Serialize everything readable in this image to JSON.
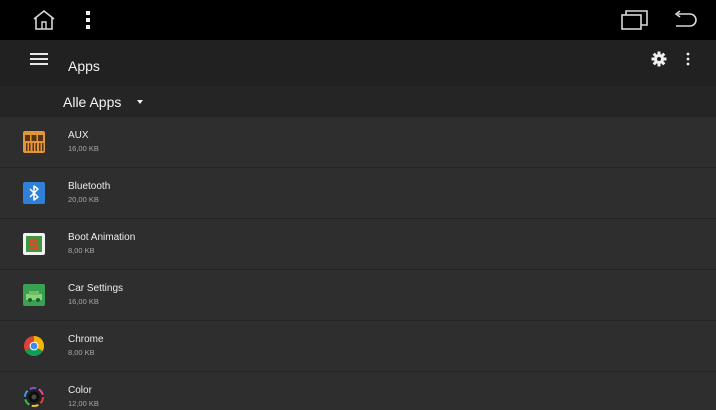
{
  "system_bar": {
    "icons": [
      "home-icon",
      "vertical-dots-icon",
      "recent-apps-icon",
      "back-icon"
    ]
  },
  "toolbar": {
    "title": "Apps",
    "icons": [
      "hamburger-menu-icon",
      "settings-gear-icon",
      "overflow-menu-icon"
    ]
  },
  "filter": {
    "selected": "Alle Apps"
  },
  "apps": [
    {
      "name": "AUX",
      "size": "16,00 KB",
      "icon": "aux-icon"
    },
    {
      "name": "Bluetooth",
      "size": "20,00 KB",
      "icon": "bluetooth-icon"
    },
    {
      "name": "Boot Animation",
      "size": "8,00 KB",
      "icon": "boot-animation-icon"
    },
    {
      "name": "Car Settings",
      "size": "16,00 KB",
      "icon": "car-settings-icon"
    },
    {
      "name": "Chrome",
      "size": "8,00 KB",
      "icon": "chrome-icon"
    },
    {
      "name": "Color",
      "size": "12,00 KB",
      "icon": "color-icon"
    }
  ],
  "colors": {
    "system_bar": "#000000",
    "toolbar": "#212121",
    "list_row": "#2e2e2e",
    "bluetooth_blue": "#2f80d8",
    "aux_orange": "#e3953a"
  }
}
